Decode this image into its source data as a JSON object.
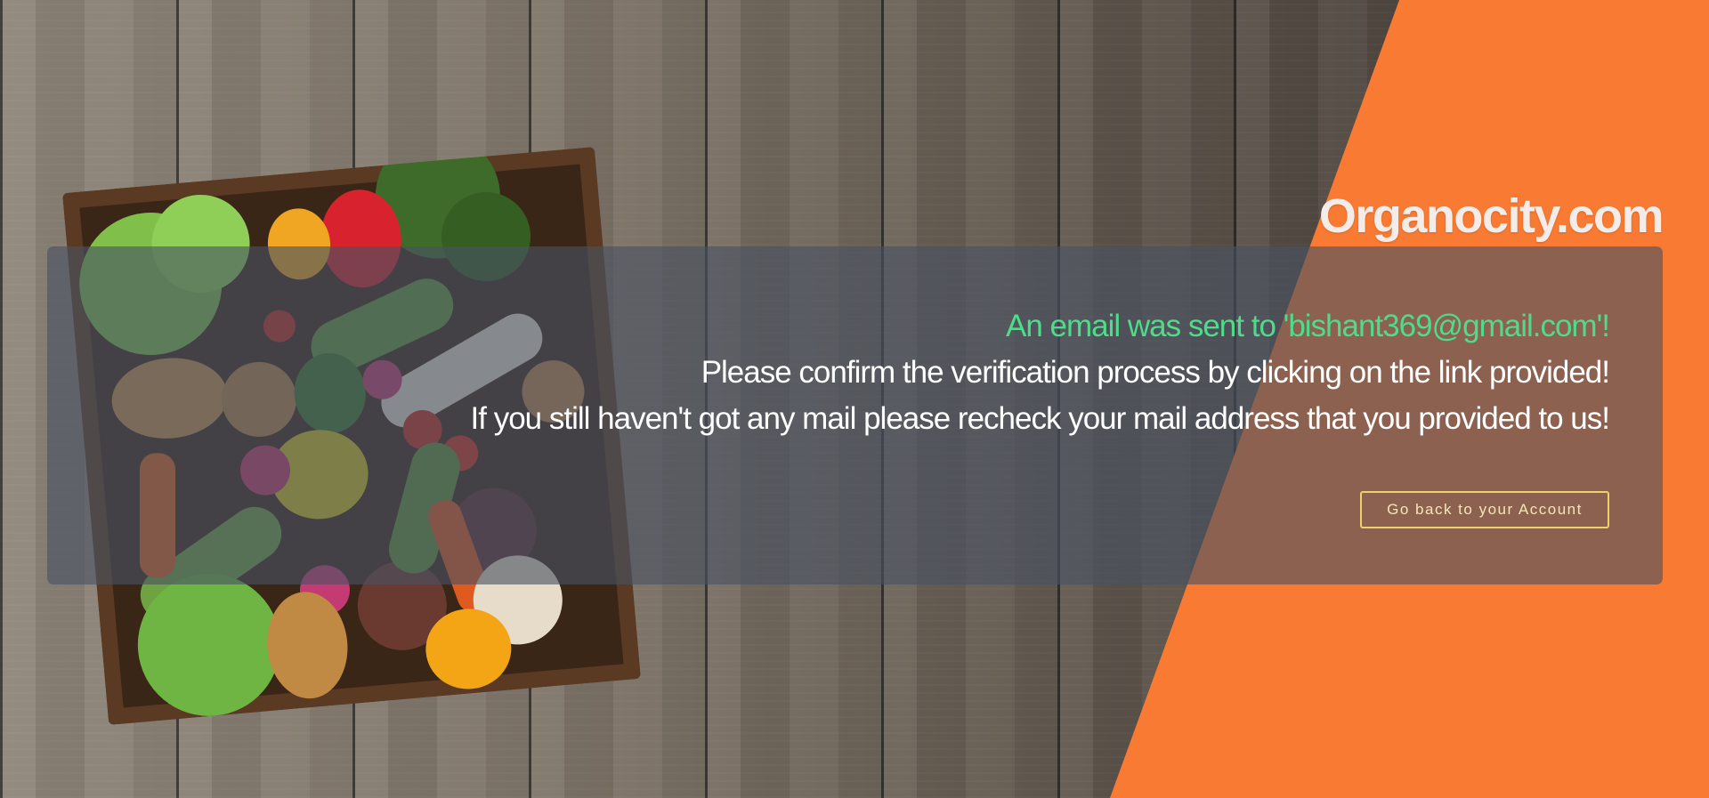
{
  "brand": {
    "name": "Organocity.com"
  },
  "message": {
    "email_sent": "An email was sent to 'bishant369@gmail.com'!",
    "confirm": "Please confirm the verification process by clicking on the link provided!",
    "recheck": "If you still haven't got any mail please recheck your mail address that you provided to us!"
  },
  "actions": {
    "back_label": "Go back to your Account"
  },
  "colors": {
    "accent_orange": "#f97a32",
    "email_green": "#4fdc8a",
    "button_border": "#f1cf6a"
  }
}
